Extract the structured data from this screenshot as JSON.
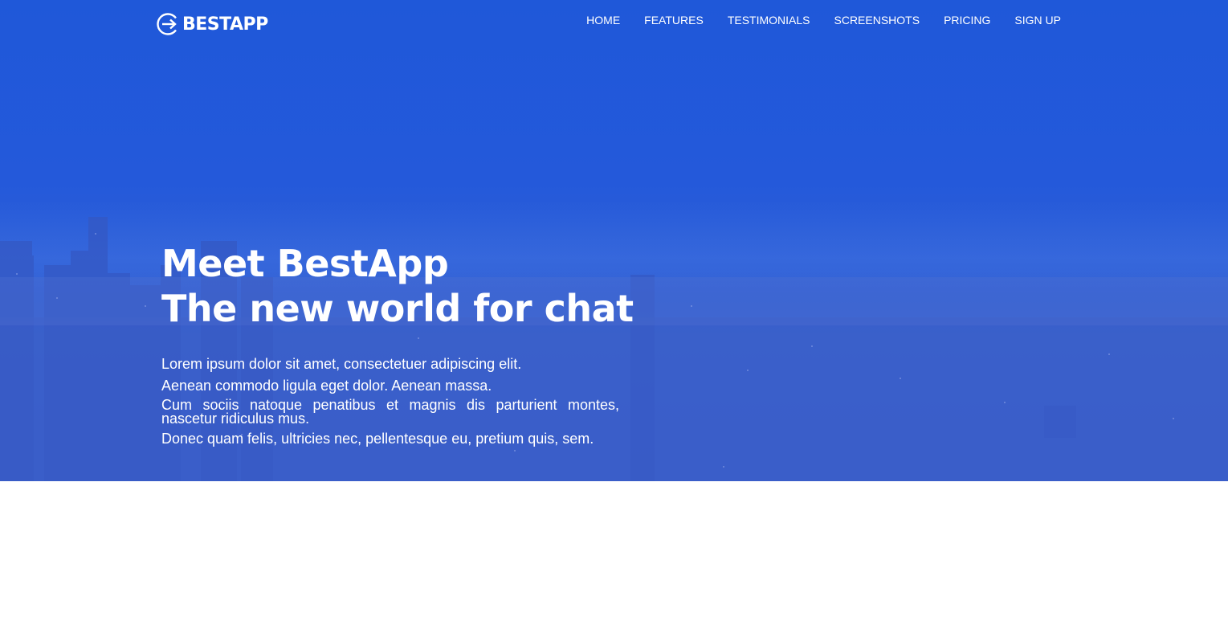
{
  "brand": {
    "name": "BESTAPP",
    "icon": "circle-arrow-right-icon",
    "color": "#ffffff"
  },
  "nav": {
    "items": [
      {
        "label": "HOME"
      },
      {
        "label": "FEATURES"
      },
      {
        "label": "TESTIMONIALS"
      },
      {
        "label": "SCREENSHOTS"
      },
      {
        "label": "PRICING"
      },
      {
        "label": "SIGN UP"
      }
    ]
  },
  "hero": {
    "headline_line1": "Meet BestApp",
    "headline_line2": "The new world for chat",
    "paragraphs": [
      "Lorem ipsum dolor sit amet, consectetuer adipiscing elit.",
      "Aenean commodo ligula eget dolor. Aenean massa.",
      "Cum sociis natoque penatibus et magnis dis parturient montes, nascetur ridiculus mus.",
      "Donec quam felis, ultricies nec, pellentesque eu, pretium quis, sem."
    ],
    "background_overlay_color": "#1f58d9"
  }
}
